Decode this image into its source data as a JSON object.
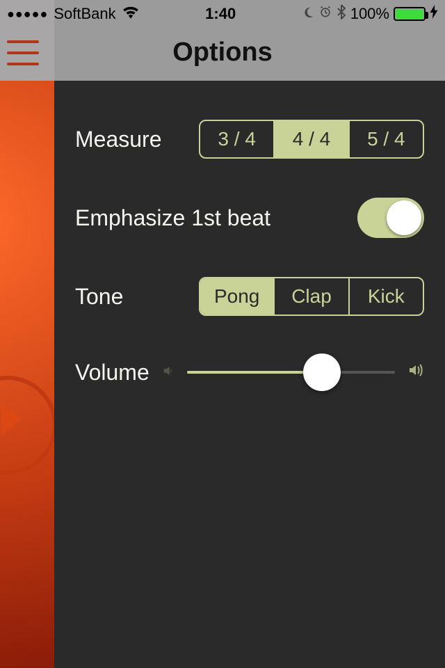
{
  "status_bar": {
    "carrier": "SoftBank",
    "time": "1:40",
    "battery_pct": "100%"
  },
  "header": {
    "title": "Options"
  },
  "labels": {
    "measure": "Measure",
    "emphasize": "Emphasize 1st beat",
    "tone": "Tone",
    "volume": "Volume"
  },
  "measure": {
    "options": [
      "3 / 4",
      "4 / 4",
      "5 / 4"
    ],
    "selected_index": 1
  },
  "emphasize_first_beat": true,
  "tone": {
    "options": [
      "Pong",
      "Clap",
      "Kick"
    ],
    "selected_index": 0
  },
  "volume": {
    "value_pct": 65
  },
  "colors": {
    "accent": "#c9d397",
    "panel_bg": "#2a2a2a",
    "underlay": "#b43418"
  }
}
